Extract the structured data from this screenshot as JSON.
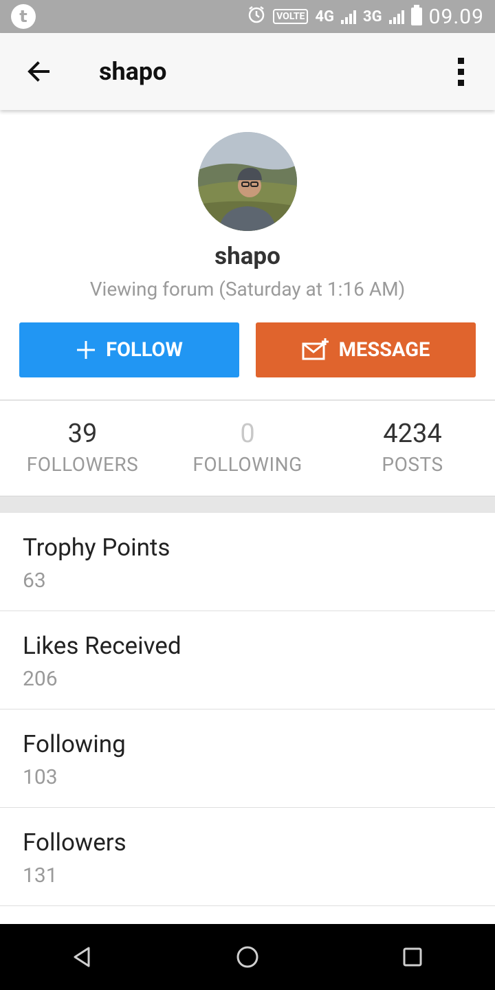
{
  "status_bar": {
    "app_badge": "t",
    "volte": "VOLTE",
    "network_1": "4G",
    "network_2": "3G",
    "time": "09.09"
  },
  "toolbar": {
    "title": "shapo"
  },
  "profile": {
    "username": "shapo",
    "activity": "Viewing forum (Saturday at 1:16 AM)"
  },
  "actions": {
    "follow_label": "FOLLOW",
    "message_label": "MESSAGE"
  },
  "stats": [
    {
      "value": "39",
      "label": "FOLLOWERS"
    },
    {
      "value": "0",
      "label": "FOLLOWING"
    },
    {
      "value": "4234",
      "label": "POSTS"
    }
  ],
  "info": [
    {
      "label": "Trophy Points",
      "value": "63"
    },
    {
      "label": "Likes Received",
      "value": "206"
    },
    {
      "label": "Following",
      "value": "103"
    },
    {
      "label": "Followers",
      "value": "131"
    }
  ],
  "colors": {
    "follow": "#2196f3",
    "message": "#e0642d",
    "status_bar": "#a9a9a9"
  }
}
